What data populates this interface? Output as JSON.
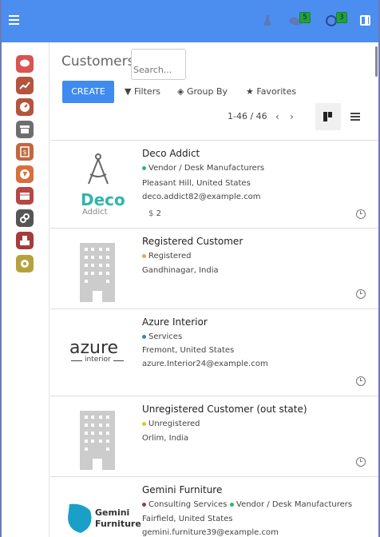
{
  "header": {
    "badge_messages": "5",
    "badge_activities": "3"
  },
  "page": {
    "title": "Customers"
  },
  "search": {
    "placeholder": "Search..."
  },
  "toolbar": {
    "create_label": "CREATE",
    "filters_label": "Filters",
    "groupby_label": "Group By",
    "favorites_label": "Favorites"
  },
  "pager": {
    "range": "1-46 / 46"
  },
  "sidebar": {
    "apps": [
      {
        "icon": "discuss-icon",
        "color": "#d9534f"
      },
      {
        "icon": "chart-icon",
        "color": "#b5543d"
      },
      {
        "icon": "gauge-icon",
        "color": "#b5543d"
      },
      {
        "icon": "shop-icon",
        "color": "#6e6e6e"
      },
      {
        "icon": "invoice-icon",
        "color": "#c0683e"
      },
      {
        "icon": "globe-icon",
        "color": "#d86f3c"
      },
      {
        "icon": "box-icon",
        "color": "#b54744"
      },
      {
        "icon": "link-icon",
        "color": "#555555"
      },
      {
        "icon": "modules-icon",
        "color": "#a53c38"
      },
      {
        "icon": "settings-icon",
        "color": "#b5a23c"
      }
    ]
  },
  "customers": [
    {
      "name": "Deco Addict",
      "tags": [
        {
          "label": "Vendor / Desk Manufacturers",
          "color": "#2bb673"
        }
      ],
      "location": "Pleasant Hill, United States",
      "email": "deco.addict82@example.com",
      "stat": "2"
    },
    {
      "name": "Registered Customer",
      "tags": [
        {
          "label": "Registered",
          "color": "#f0a05a"
        }
      ],
      "location": "Gandhinagar, India",
      "email": "",
      "stat": ""
    },
    {
      "name": "Azure Interior",
      "tags": [
        {
          "label": "Services",
          "color": "#2e86c1"
        }
      ],
      "location": "Fremont, United States",
      "email": "azure.Interior24@example.com",
      "stat": ""
    },
    {
      "name": "Unregistered Customer (out state)",
      "tags": [
        {
          "label": "Unregistered",
          "color": "#e6c229"
        }
      ],
      "location": "Orlim, India",
      "email": "",
      "stat": ""
    },
    {
      "name": "Gemini Furniture",
      "tags": [
        {
          "label": "Consulting Services",
          "color": "#8e3b5a"
        },
        {
          "label": "Vendor / Desk Manufacturers",
          "color": "#2bb673"
        }
      ],
      "location": "Fairfield, United States",
      "email": "gemini.furniture39@example.com",
      "stat": ""
    }
  ],
  "logos": {
    "deco_line1": "Deco",
    "deco_line2": "Addict",
    "azure_line1": "azure",
    "azure_line2": "interior",
    "gemini_line1": "Gemini",
    "gemini_line2": "Furniture"
  }
}
